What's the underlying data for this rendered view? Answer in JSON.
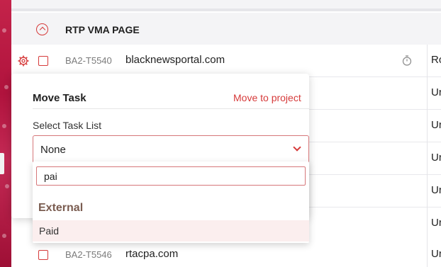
{
  "group": {
    "title": "RTP VMA PAGE"
  },
  "tasks": [
    {
      "id": "BA2-T5540",
      "name": "blacknewsportal.com",
      "owner": "Ro"
    },
    {
      "owner": "Ur"
    },
    {
      "owner": "Ur"
    },
    {
      "owner": "Ur"
    },
    {
      "owner": "Ur"
    },
    {
      "owner": "Ur"
    },
    {
      "id": "BA2-T5546",
      "name": "rtacpa.com",
      "owner": "Ur"
    }
  ],
  "move_task": {
    "title": "Move Task",
    "link": "Move to project",
    "select_label": "Select Task List",
    "selected_value": "None",
    "search_value": "pai",
    "groups": [
      {
        "name": "External",
        "options": [
          {
            "label": "Paid",
            "highlighted": true
          }
        ]
      }
    ]
  },
  "colors": {
    "accent": "#d63a3a",
    "header_bg": "#f4f4f6",
    "option_highlight": "#fbeeee"
  }
}
